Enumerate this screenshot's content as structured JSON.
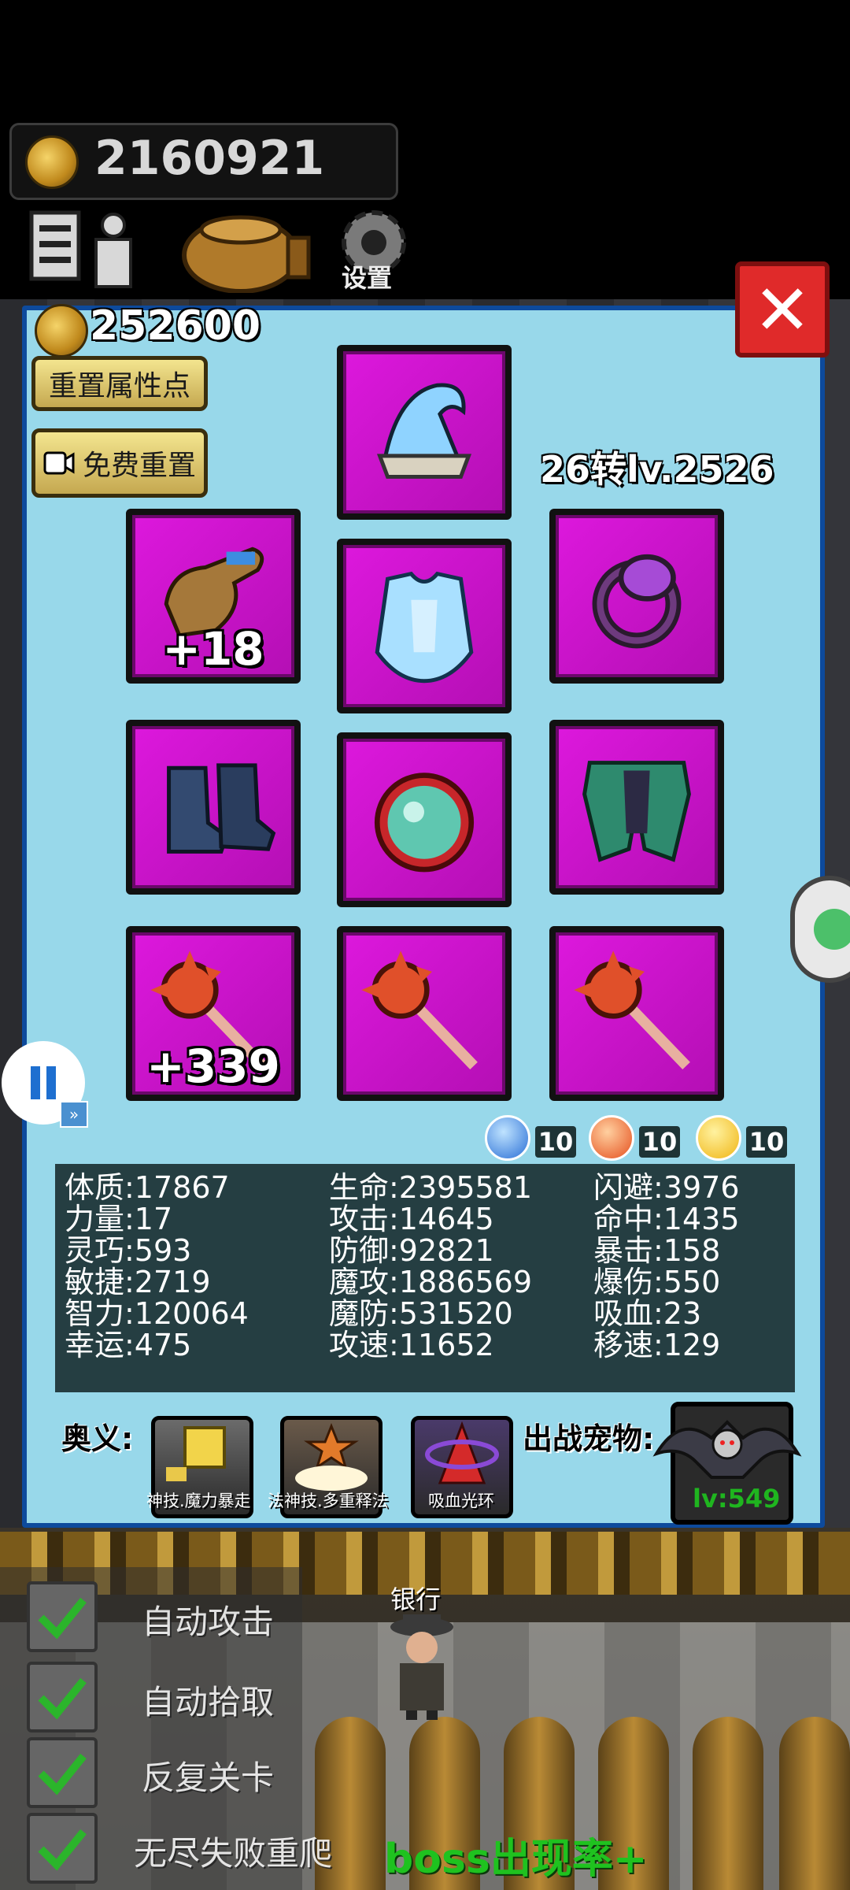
{
  "top_bar": {
    "gold": "2160921",
    "settings_label": "设置"
  },
  "panel": {
    "gold": "252600",
    "reset_points_label": "重置属性点",
    "free_reset_label": "免费重置",
    "level_text": "26转lv.2526",
    "slots": [
      {
        "icon": "wizard-hat-icon",
        "plus": ""
      },
      {
        "icon": "gauntlet-icon",
        "plus": "+18"
      },
      {
        "icon": "armor-vest-icon",
        "plus": ""
      },
      {
        "icon": "ring-icon",
        "plus": ""
      },
      {
        "icon": "boots-icon",
        "plus": ""
      },
      {
        "icon": "orb-amulet-icon",
        "plus": ""
      },
      {
        "icon": "pants-icon",
        "plus": ""
      },
      {
        "icon": "spiked-mace-icon",
        "plus": "+339"
      },
      {
        "icon": "spiked-mace-icon",
        "plus": ""
      },
      {
        "icon": "spiked-mace-icon",
        "plus": ""
      }
    ],
    "gems": [
      {
        "type": "water-gem-icon",
        "count": "10",
        "color": "#2a6fd6"
      },
      {
        "type": "fire-gem-icon",
        "count": "10",
        "color": "#e5501e"
      },
      {
        "type": "lightning-gem-icon",
        "count": "10",
        "color": "#f0b514"
      }
    ],
    "stats": [
      "体质:17867",
      "力量:17",
      "灵巧:593",
      "敏捷:2719",
      "智力:120064",
      "幸运:475",
      "生命:2395581",
      "攻击:14645",
      "防御:92821",
      "魔攻:1886569",
      "魔防:531520",
      "攻速:11652",
      "闪避:3976",
      "命中:1435",
      "暴击:158",
      "爆伤:550",
      "吸血:23",
      "移速:129"
    ],
    "skills_label": "奥义:",
    "skills": [
      "神技.魔力暴走",
      "法神技.多重释法",
      "吸血光环"
    ],
    "pet_label": "出战宠物:",
    "pet_level": "lv:549"
  },
  "bottom": {
    "bank_label": "银行",
    "checks": [
      "自动攻击",
      "自动拾取",
      "反复关卡",
      "无尽失败重爬"
    ],
    "boss_text": "boss出现率+"
  }
}
